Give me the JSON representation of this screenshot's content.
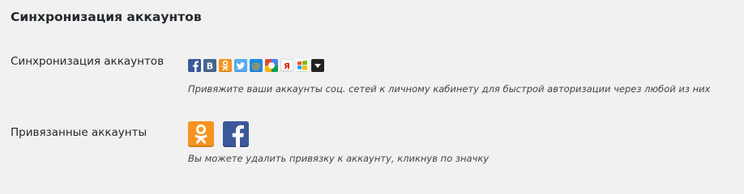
{
  "section": {
    "title": "Синхронизация аккаунтов"
  },
  "sync": {
    "label": "Синхронизация аккаунтов",
    "description": "Привяжите ваши аккаунты соц. сетей к личному кабинету для быстрой авторизации через любой из них",
    "icons": [
      {
        "name": "facebook-icon",
        "glyph": "f",
        "color": "#3b5998"
      },
      {
        "name": "vkontakte-icon",
        "glyph": "B",
        "color": "#45668e"
      },
      {
        "name": "odnoklassniki-icon",
        "glyph": "ok",
        "color": "#f7931e"
      },
      {
        "name": "twitter-icon",
        "glyph": "t",
        "color": "#55acee"
      },
      {
        "name": "mailru-icon",
        "glyph": "@",
        "color": "#168de2"
      },
      {
        "name": "google-icon",
        "glyph": "g",
        "color": "#4c8c2f"
      },
      {
        "name": "yandex-icon",
        "glyph": "Я",
        "color": "#ffffff"
      },
      {
        "name": "windows-live-icon",
        "glyph": "w",
        "color": "#ffffff"
      },
      {
        "name": "more-dropdown-icon",
        "glyph": "▼",
        "color": "#222222"
      }
    ]
  },
  "linked": {
    "label": "Привязанные аккаунты",
    "description": "Вы можете удалить привязку к аккаунту, кликнув по значку",
    "accounts": [
      {
        "name": "linked-odnoklassniki-icon",
        "color": "#f7931e"
      },
      {
        "name": "linked-facebook-icon",
        "color": "#3b5998"
      }
    ]
  }
}
